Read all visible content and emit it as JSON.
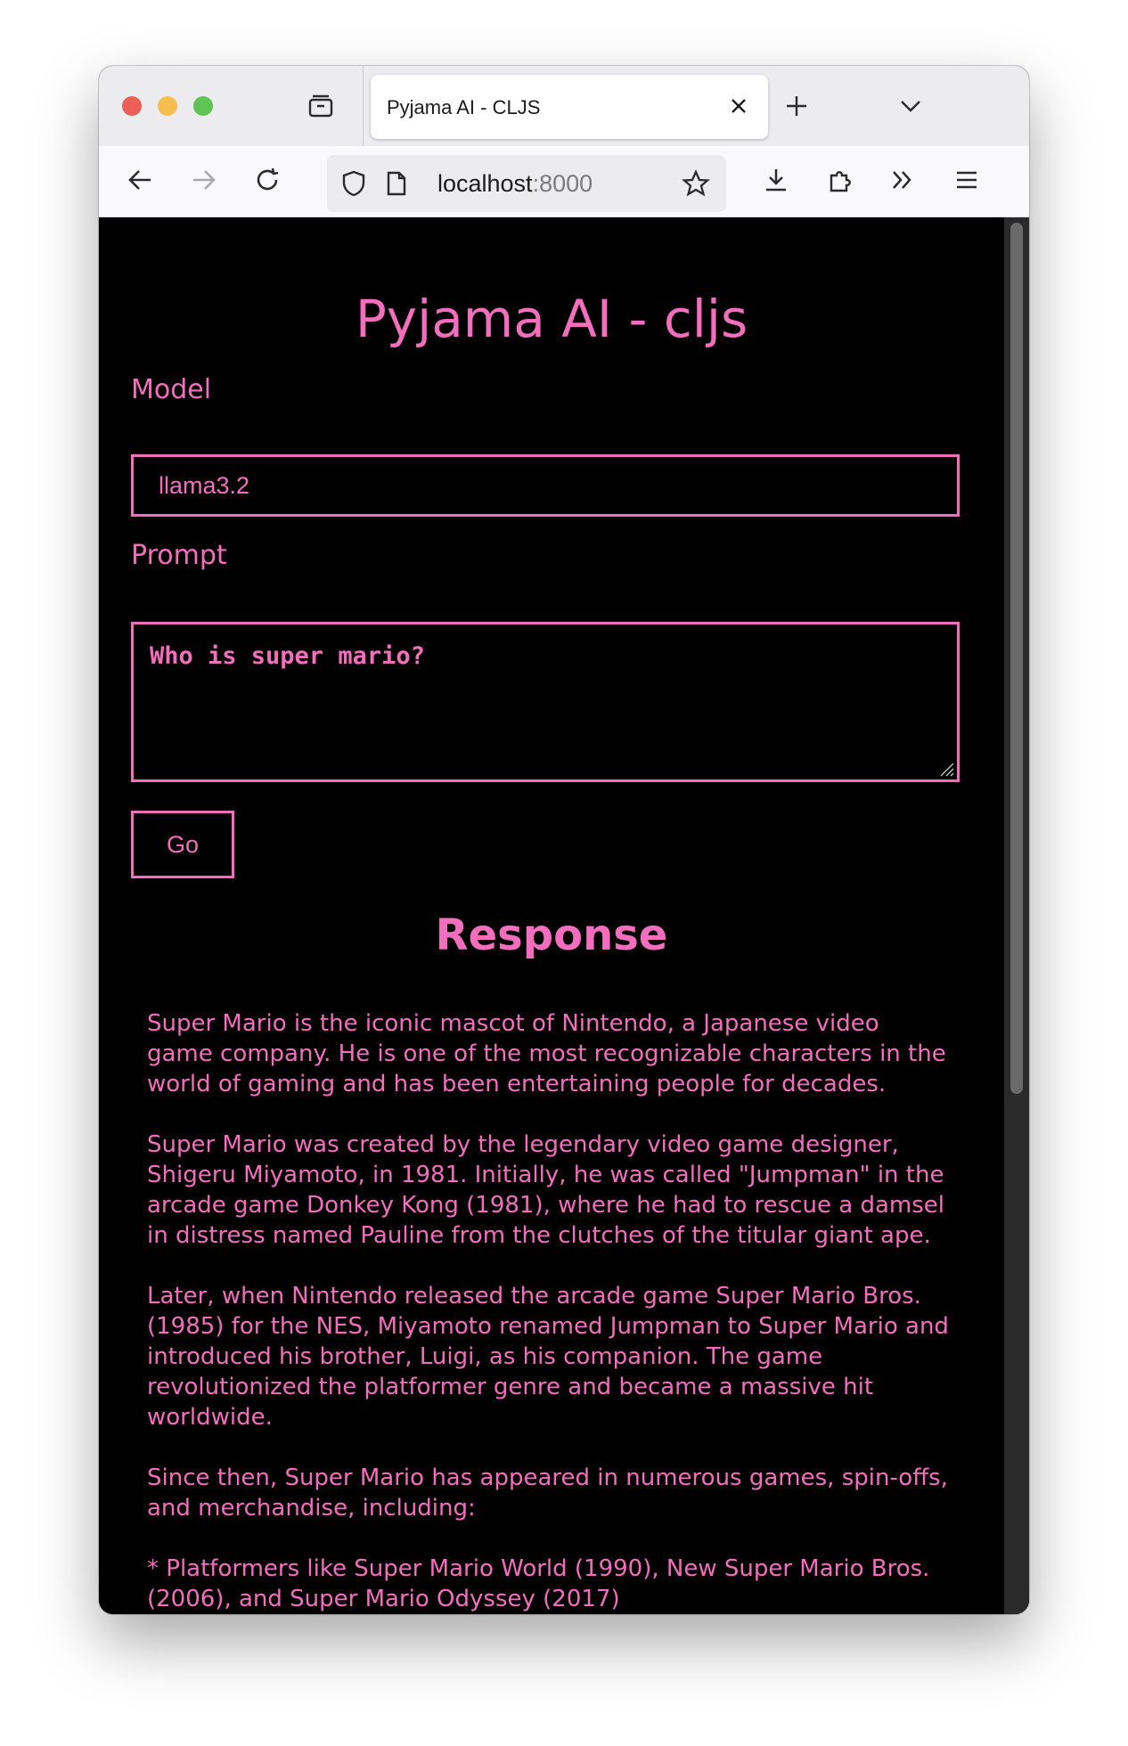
{
  "browser": {
    "tab_title": "Pyjama AI - CLJS",
    "url_host": "localhost",
    "url_port": ":8000"
  },
  "page": {
    "title": "Pyjama AI - cljs",
    "model_label": "Model",
    "model_value": "llama3.2",
    "prompt_label": "Prompt",
    "prompt_value": "Who is super mario?",
    "go_label": "Go",
    "response_title": "Response",
    "response_paragraphs": [
      "Super Mario is the iconic mascot of Nintendo, a Japanese video game company. He is one of the most recognizable characters in the world of gaming and has been entertaining people for decades.",
      "Super Mario was created by the legendary video game designer, Shigeru Miyamoto, in 1981. Initially, he was called \"Jumpman\" in the arcade game Donkey Kong (1981), where he had to rescue a damsel in distress named Pauline from the clutches of the titular giant ape.",
      "Later, when Nintendo released the arcade game Super Mario Bros. (1985) for the NES, Miyamoto renamed Jumpman to Super Mario and introduced his brother, Luigi, as his companion. The game revolutionized the platformer genre and became a massive hit worldwide.",
      "Since then, Super Mario has appeared in numerous games, spin-offs, and merchandise, including:",
      "* Platformers like Super Mario World (1990), New Super Mario Bros. (2006), and Super Mario Odyssey (2017)"
    ]
  },
  "colors": {
    "accent": "#f36ebd",
    "background": "#000000"
  },
  "icons": [
    "tab-overview-icon",
    "new-tab-icon",
    "tab-list-icon",
    "back-icon",
    "forward-icon",
    "reload-icon",
    "shield-icon",
    "page-icon",
    "bookmark-star-icon",
    "download-icon",
    "extensions-icon",
    "overflow-icon",
    "menu-icon",
    "close-icon"
  ]
}
